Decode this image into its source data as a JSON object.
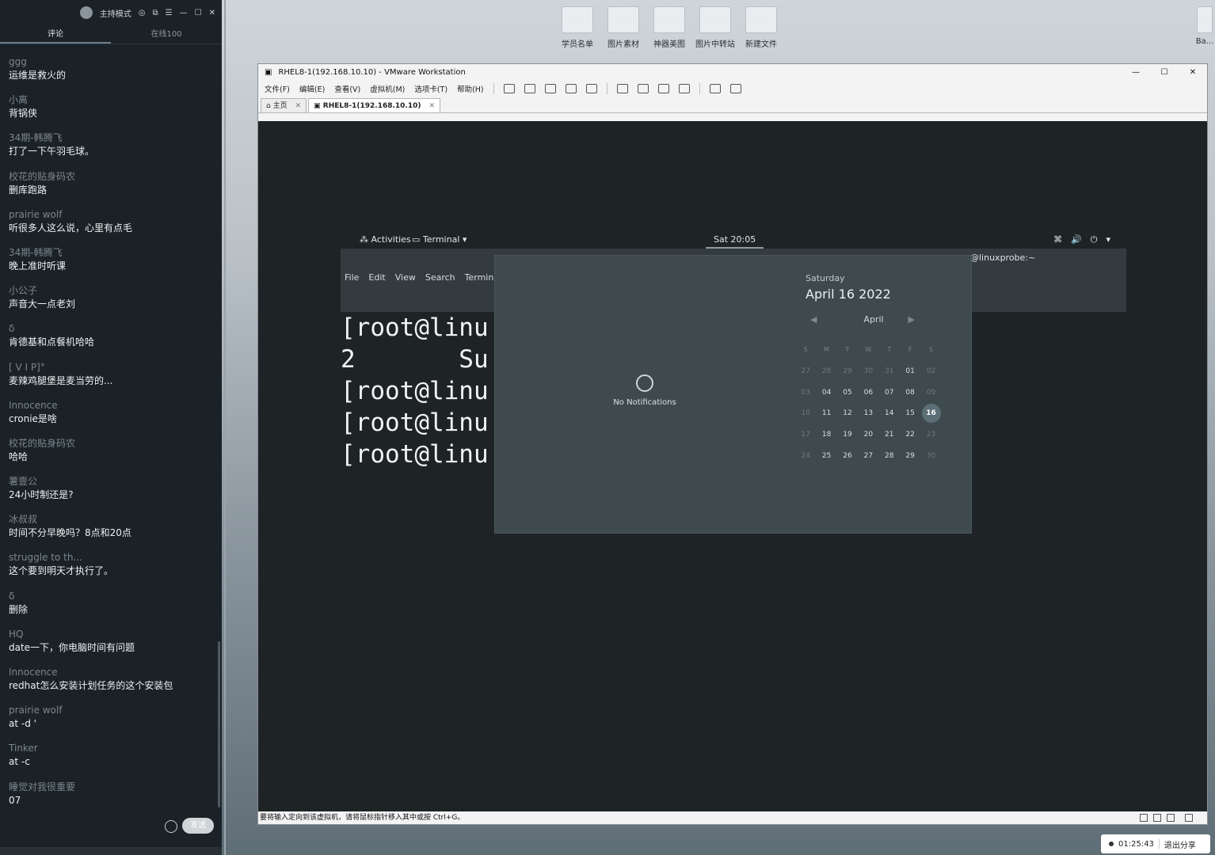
{
  "chat": {
    "mode": "主持模式",
    "tabs": [
      "评论",
      "在线100"
    ],
    "messages": [
      {
        "nick": "ggg",
        "text": "运维是救火的"
      },
      {
        "nick": "小离",
        "text": "背锅侠"
      },
      {
        "nick": "34期-韩腾飞",
        "text": "打了一下午羽毛球。"
      },
      {
        "nick": "校花的贴身码农",
        "text": "删库跑路"
      },
      {
        "nick": "prairie wolf",
        "text": "听很多人这么说，心里有点毛"
      },
      {
        "nick": "34期-韩腾飞",
        "text": "晚上准时听课"
      },
      {
        "nick": "小公子",
        "text": "声音大一点老刘"
      },
      {
        "nick": "δ",
        "text": "肯德基和点餐机哈哈"
      },
      {
        "nick": "[ V I P]°",
        "text": "麦辣鸡腿堡是麦当劳的..."
      },
      {
        "nick": "Innocence",
        "text": "cronie是啥"
      },
      {
        "nick": "校花的贴身码农",
        "text": "哈哈"
      },
      {
        "nick": "薯壹公",
        "text": "24小时制还是?"
      },
      {
        "nick": "冰叔叔",
        "text": "时间不分早晚吗？8点和20点"
      },
      {
        "nick": "struggle to th...",
        "text": "这个要到明天才执行了。"
      },
      {
        "nick": "δ",
        "text": "删除"
      },
      {
        "nick": "HQ",
        "text": "date一下，你电脑时间有问题"
      },
      {
        "nick": "Innocence",
        "text": "redhat怎么安装计划任务的这个安装包"
      },
      {
        "nick": "prairie wolf",
        "text": "at -d '"
      },
      {
        "nick": "Tinker",
        "text": "at -c"
      },
      {
        "nick": "睡觉对我很重要",
        "text": "07"
      }
    ],
    "send_label": "发送"
  },
  "desktop_icons": [
    "学员名单",
    "图片素材",
    "神器美图",
    "图片中转站",
    "新建文件"
  ],
  "desktop_icon_right": "Ba...",
  "vmware": {
    "title": "RHEL8-1(192.168.10.10) - VMware Workstation",
    "menus": [
      "文件(F)",
      "编辑(E)",
      "查看(V)",
      "虚拟机(M)",
      "选项卡(T)",
      "帮助(H)"
    ],
    "tabs": [
      "主页",
      "RHEL8-1(192.168.10.10)"
    ],
    "status_text": "要将输入定向到该虚拟机，请将鼠标指针移入其中或按 Ctrl+G。"
  },
  "gnome": {
    "activities": "Activities",
    "app_menu": "Terminal",
    "clock": "Sat 20:05",
    "terminal_title": "@linuxprobe:~",
    "terminal_menu": [
      "File",
      "Edit",
      "View",
      "Search",
      "Terminal"
    ],
    "terminal_lines": [
      "[root@linu",
      "2       Su",
      "[root@linu",
      "[root@linu",
      "[root@linu"
    ],
    "no_notifications": "No Notifications",
    "calendar": {
      "weekday": "Saturday",
      "date": "April 16 2022",
      "month": "April",
      "headers": [
        "S",
        "M",
        "T",
        "W",
        "T",
        "F",
        "S"
      ],
      "weeks": [
        [
          "27",
          "28",
          "29",
          "30",
          "31",
          "01",
          "02"
        ],
        [
          "03",
          "04",
          "05",
          "06",
          "07",
          "08",
          "09"
        ],
        [
          "10",
          "11",
          "12",
          "13",
          "14",
          "15",
          "16"
        ],
        [
          "17",
          "18",
          "19",
          "20",
          "21",
          "22",
          "23"
        ],
        [
          "24",
          "25",
          "26",
          "27",
          "28",
          "29",
          "30"
        ]
      ],
      "today": "16"
    }
  },
  "share": {
    "time": "01:25:43",
    "exit_label": "退出分享"
  }
}
